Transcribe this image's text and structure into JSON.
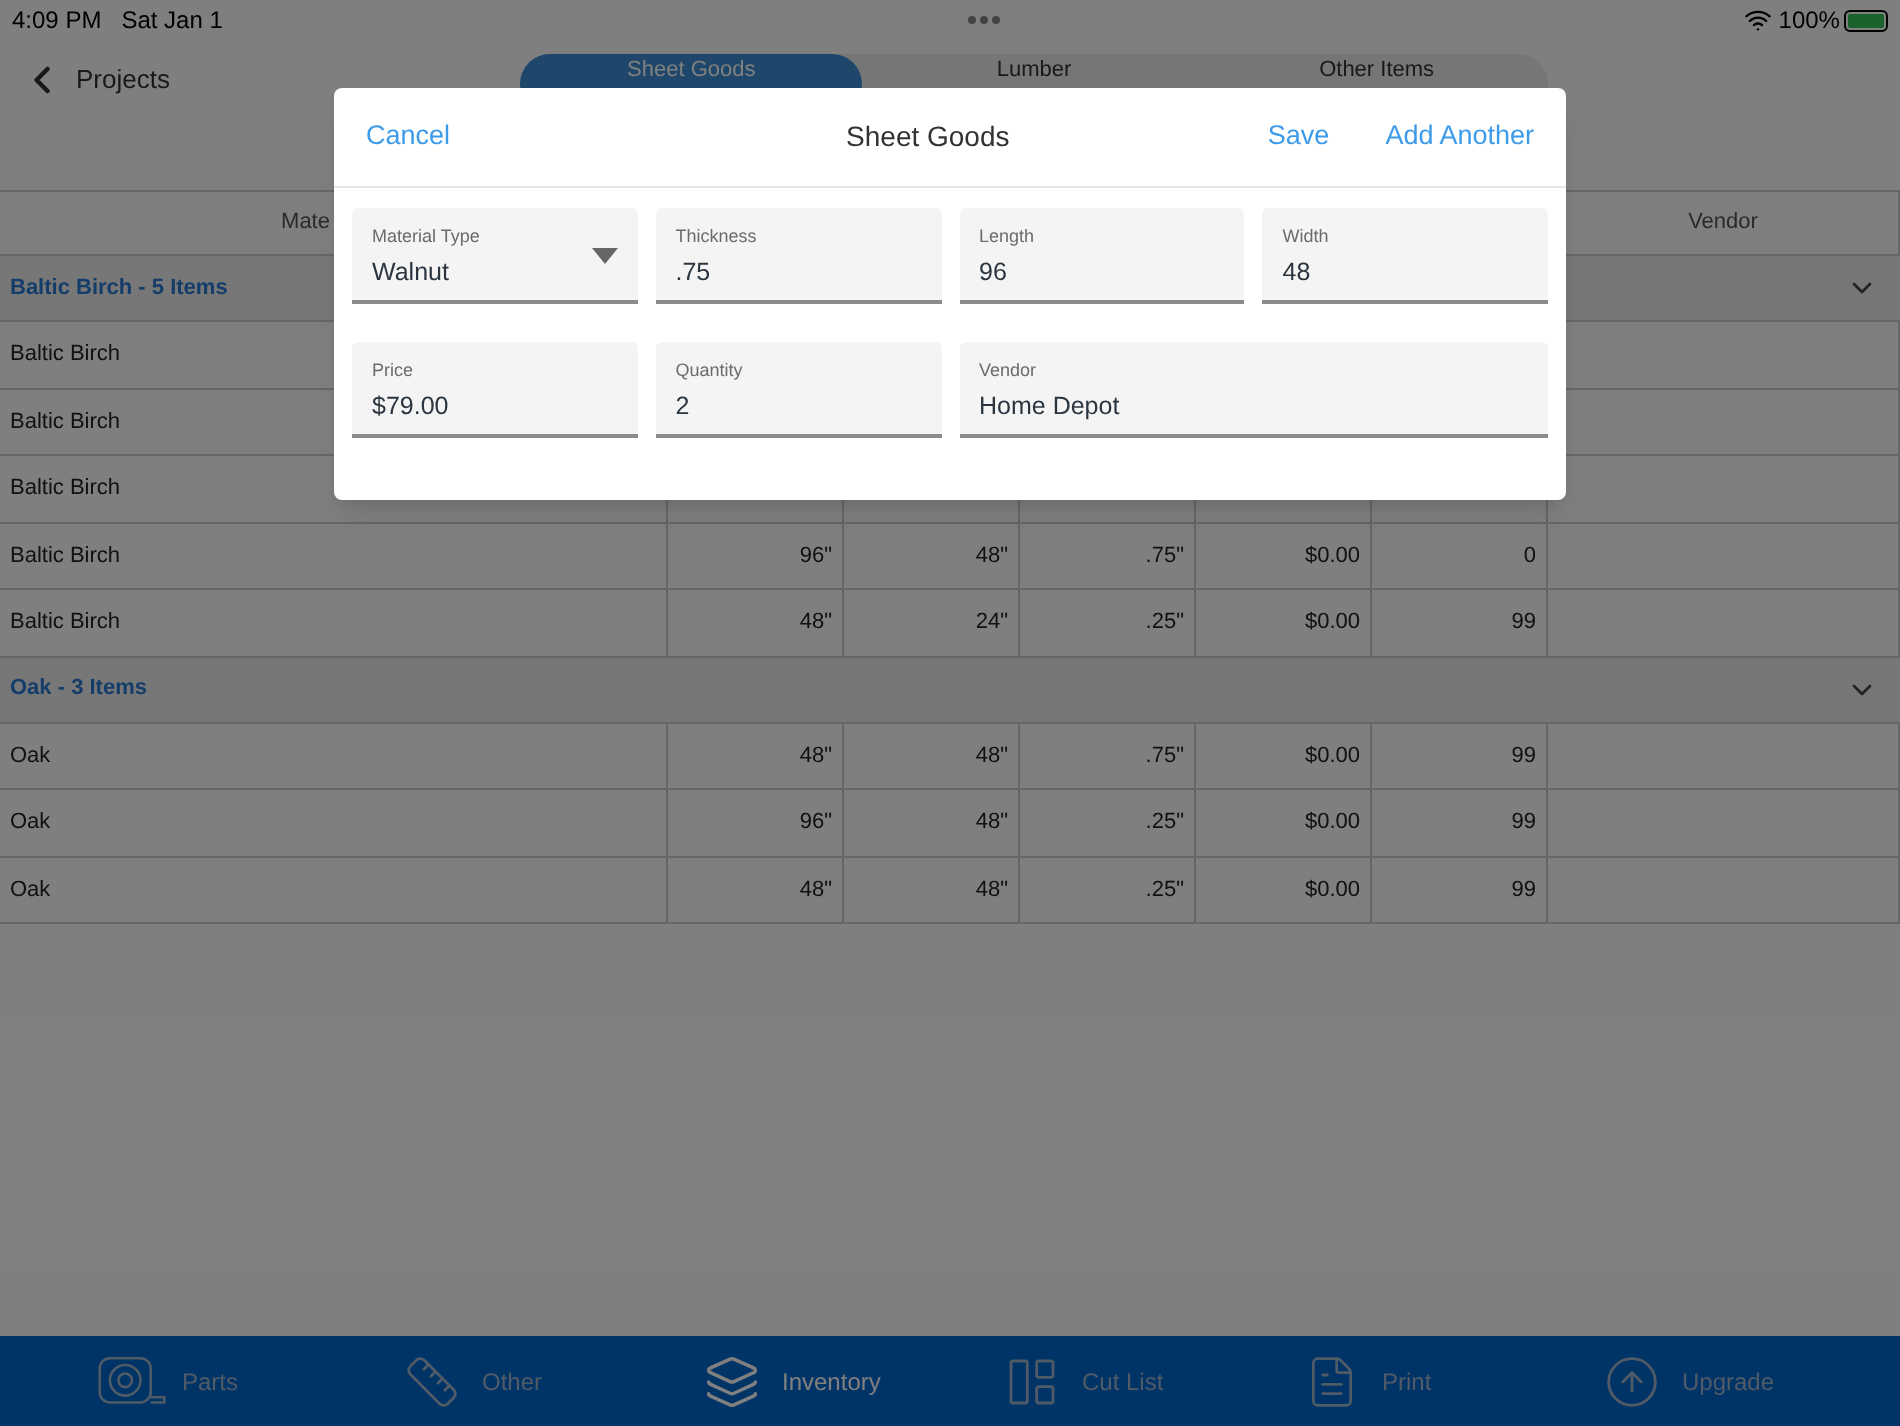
{
  "status_bar": {
    "time": "4:09 PM",
    "date": "Sat Jan 1",
    "battery": "100%",
    "charging": true
  },
  "nav": {
    "back_label": "Projects"
  },
  "tabs": [
    {
      "label": "Sheet Goods",
      "selected": true
    },
    {
      "label": "Lumber",
      "selected": false
    },
    {
      "label": "Other Items",
      "selected": false
    }
  ],
  "table": {
    "columns": [
      "Mate",
      "",
      "",
      "",
      "",
      "",
      "Vendor"
    ],
    "groups": [
      {
        "title": "Baltic Birch - 5 Items",
        "expanded": true,
        "rows": [
          {
            "cells": [
              "Baltic Birch"
            ]
          },
          {
            "cells": [
              "Baltic Birch"
            ]
          },
          {
            "cells": [
              "Baltic Birch"
            ]
          },
          {
            "cells": [
              "Baltic Birch",
              "96\"",
              "48\"",
              ".75\"",
              "$0.00",
              "0",
              ""
            ]
          },
          {
            "cells": [
              "Baltic Birch",
              "48\"",
              "24\"",
              ".25\"",
              "$0.00",
              "99",
              ""
            ]
          }
        ]
      },
      {
        "title": "Oak - 3 Items",
        "expanded": true,
        "rows": [
          {
            "cells": [
              "Oak",
              "48\"",
              "48\"",
              ".75\"",
              "$0.00",
              "99",
              ""
            ]
          },
          {
            "cells": [
              "Oak",
              "96\"",
              "48\"",
              ".25\"",
              "$0.00",
              "99",
              ""
            ]
          },
          {
            "cells": [
              "Oak",
              "48\"",
              "48\"",
              ".25\"",
              "$0.00",
              "99",
              ""
            ]
          }
        ]
      }
    ]
  },
  "dialog": {
    "cancel": "Cancel",
    "title": "Sheet Goods",
    "save": "Save",
    "add_another": "Add Another",
    "fields": [
      {
        "label": "Material Type",
        "value": "Walnut",
        "kind": "select"
      },
      {
        "label": "Thickness",
        "value": ".75",
        "kind": "text"
      },
      {
        "label": "Length",
        "value": "96",
        "kind": "text"
      },
      {
        "label": "Width",
        "value": "48",
        "kind": "text"
      },
      {
        "label": "Price",
        "value": "$79.00",
        "kind": "text"
      },
      {
        "label": "Quantity",
        "value": "2",
        "kind": "text"
      },
      {
        "label": "Vendor",
        "value": "Home Depot",
        "kind": "wide"
      }
    ]
  },
  "bottom_tabs": [
    {
      "label": "Parts",
      "selected": false
    },
    {
      "label": "Other",
      "selected": false
    },
    {
      "label": "Inventory",
      "selected": true
    },
    {
      "label": "Cut List",
      "selected": false
    },
    {
      "label": "Print",
      "selected": false
    },
    {
      "label": "Upgrade",
      "selected": false
    }
  ]
}
